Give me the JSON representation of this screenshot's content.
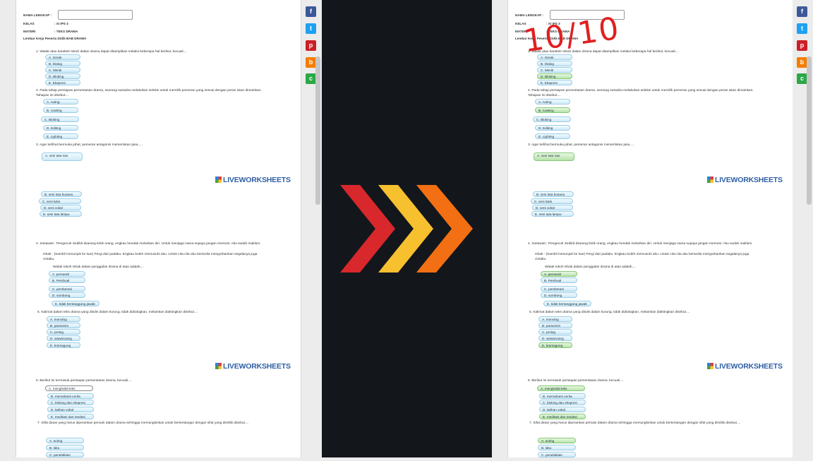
{
  "header": {
    "name_label": "NAMA LENGKAP :",
    "class_label": "KELAS",
    "class_value": ": XI IPS 3",
    "material_label": "MATERI",
    "material_value": ": TEKS DRAMA",
    "worksheet_title": "Lembar Kerja Peserta Didik  BAB DRAMA"
  },
  "share_icons": [
    "f",
    "t",
    "p",
    "b",
    "c"
  ],
  "logo_text": "LIVEWORKSHEETS",
  "score": "10/10",
  "questions": [
    {
      "text": "1.  Watak atau karakter tokoh dalam drama dapat ditampilkan melalui beberapa hal berikut, kecuali....",
      "options": [
        "A.    Gerak",
        "B.    Dialog",
        "C.    Mimik",
        "D.    Bloking",
        "E.    Ekspresi"
      ]
    },
    {
      "text": "2. Pada tahap persiapan pementasan drama, seorang sutradra melakukan seleksi untuk memilih pemeran yang sesuai dengan peran akan dimainkan. Tahapan ini disebut....",
      "options": [
        "A.     Acting",
        "B.     Casting",
        "C.        Bloking",
        "D.     Editing",
        "E.     Lighting"
      ]
    },
    {
      "text": "3.  Agar terlihat bermuka jahat, pemeran antagonis memerlukan jasa.....",
      "options": [
        "A. seni tata rias",
        "B. seni tata busana",
        "C. seni lukis",
        "D. seni vokal",
        "E. seni tata lampu"
      ]
    },
    {
      "text": "4. Sotiawati : Pengecut! Sedikit dsarang kritik orang, engkau hendak melarikan diri. Untuk menjaga nama supaya jangan mersost. Aku sudah maklum.",
      "text2": "Ishak   : (Sambil menunjuk ke luar) Pergi dari padaku. Engkau boleh memusuhi aku. Untuk cita-cita aku bersedia mengorbankan segalanya juga cintaku.",
      "text3": "Watak tokoh Ishak dalam penggalan drama di atas adalah....",
      "options": [
        "A. pemarah",
        "B. Pembual",
        "C. pemberani",
        "D. sombong",
        "E. tidak bertanggung jawab"
      ]
    },
    {
      "text": "5. Kalimat dalam teks drama yang ditulis dalam kurung, tidak didialogkan, melainkan diaktingkan disebut....",
      "options": [
        "A. monolog",
        "B. pantomim",
        "C. prolog",
        "D. wawancang",
        "E. kramagung"
      ]
    },
    {
      "text": "6. Berikut ini termasuk persiapan pementasan drama, kecuali....",
      "options": [
        "A. menghafal teks",
        "B. memahami cerita",
        "C. bloking dan ekspresi",
        "D. latihan vokal",
        "E. meditasi dan medasi"
      ]
    },
    {
      "text": "7. Sifat dasar yang harus diperankan pemain dalam drama sehingga memungkinkan untuk bertentangan dengan sifat yang dimiliki disebut....",
      "options": [
        "A. acting",
        "B. laku",
        "C. penelakitan"
      ]
    }
  ]
}
